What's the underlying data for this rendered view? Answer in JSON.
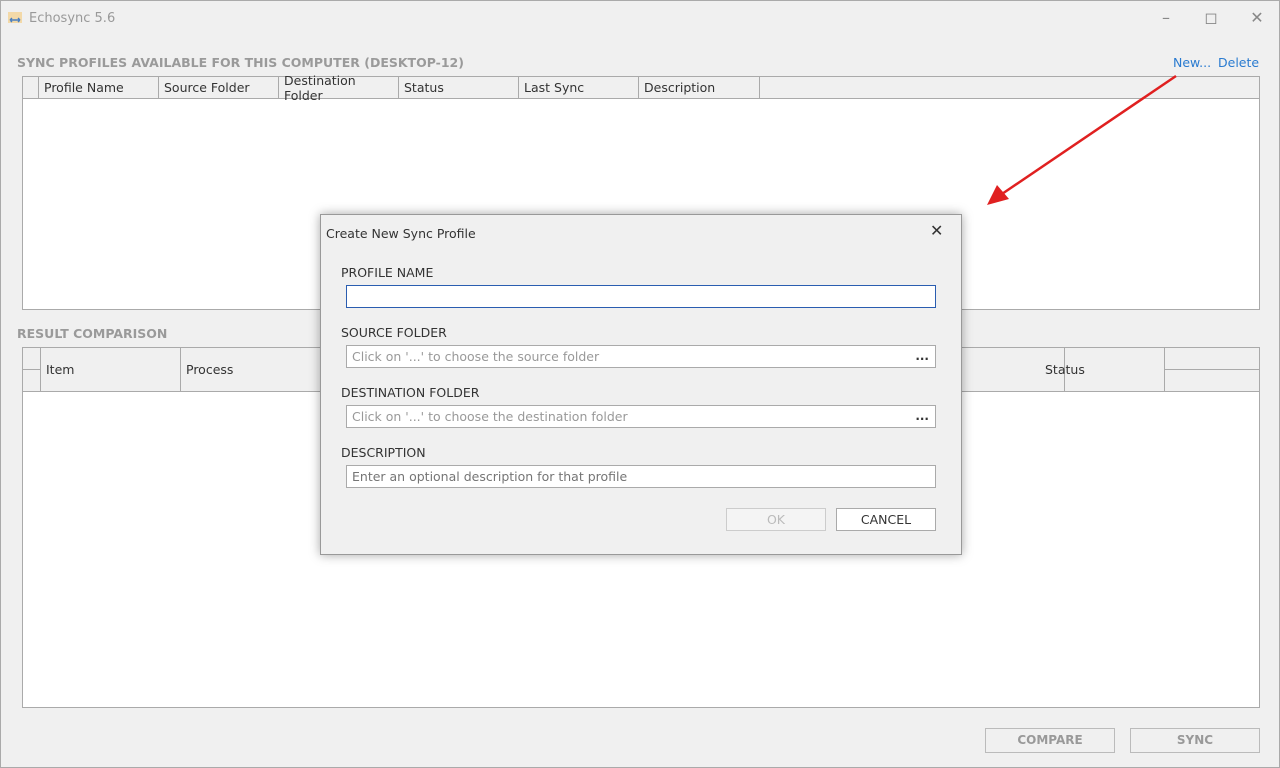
{
  "window": {
    "title": "Echosync 5.6",
    "icon": "echosync-app-icon"
  },
  "profiles": {
    "heading": "SYNC PROFILES AVAILABLE FOR THIS COMPUTER (DESKTOP-12)",
    "new_label": "New...",
    "delete_label": "Delete",
    "columns": [
      "Profile Name",
      "Source Folder",
      "Destination Folder",
      "Status",
      "Last Sync",
      "Description"
    ]
  },
  "results": {
    "heading": "RESULT COMPARISON",
    "columns": [
      "Item",
      "Process",
      "Status"
    ]
  },
  "footer": {
    "compare_label": "COMPARE",
    "sync_label": "SYNC"
  },
  "dialog": {
    "title": "Create New Sync Profile",
    "profile_name_label": "PROFILE NAME",
    "profile_name_value": "",
    "source_label": "SOURCE FOLDER",
    "source_placeholder": "Click on '...' to choose the source folder",
    "dest_label": "DESTINATION FOLDER",
    "dest_placeholder": "Click on '...' to choose the destination folder",
    "desc_label": "DESCRIPTION",
    "desc_placeholder": "Enter an optional description for that profile",
    "browse_label": "...",
    "ok_label": "OK",
    "cancel_label": "CANCEL"
  },
  "colors": {
    "accent": "#2a7bd0",
    "arrow": "#e02020",
    "focus": "#2a5db0"
  }
}
